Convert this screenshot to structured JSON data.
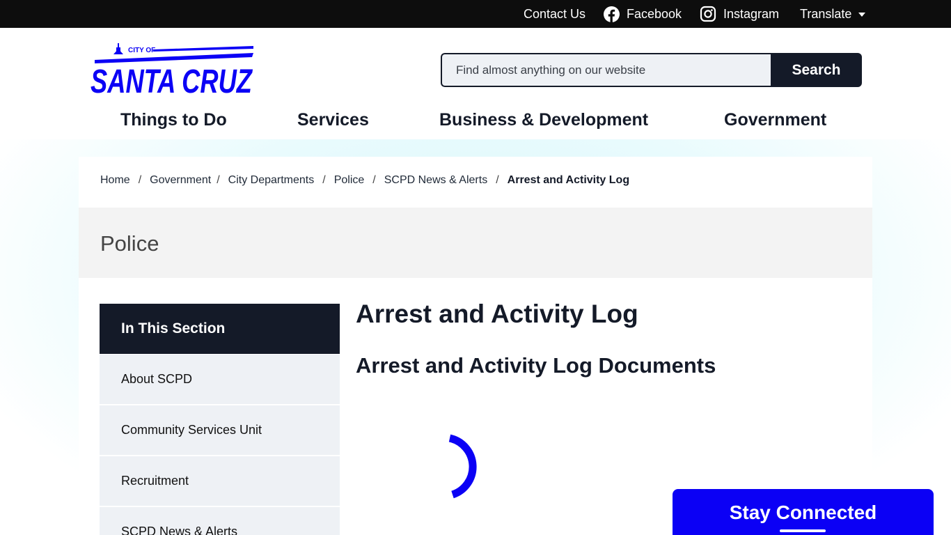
{
  "utility_bar": {
    "contact": "Contact Us",
    "facebook": "Facebook",
    "instagram": "Instagram",
    "translate": "Translate"
  },
  "logo": {
    "top_text": "CITY OF",
    "main_text": "SANTA CRUZ",
    "color": "#0b00f5"
  },
  "search": {
    "placeholder": "Find almost anything on our website",
    "value": "",
    "button": "Search"
  },
  "nav": {
    "things_to_do": "Things to Do",
    "services": "Services",
    "business": "Business & Development",
    "government": "Government"
  },
  "breadcrumb": {
    "items": [
      "Home",
      "Government",
      "City Departments",
      "Police",
      "SCPD News & Alerts"
    ],
    "current": "Arrest and Activity Log",
    "separator": "/"
  },
  "department": "Police",
  "sidebar": {
    "heading": "In This Section",
    "items": [
      "About SCPD",
      "Community Services Unit",
      "Recruitment",
      "SCPD News & Alerts"
    ]
  },
  "main": {
    "title": "Arrest and Activity Log",
    "subtitle": "Arrest and Activity Log Documents"
  },
  "stay_connected": "Stay Connected",
  "colors": {
    "brand_blue": "#0b00f5",
    "dark_navy": "#141a28",
    "top_bar": "#0d0d0d",
    "sidebar_bg": "#eef1f5"
  },
  "icons": {
    "facebook": "facebook-icon",
    "instagram": "instagram-icon",
    "translate_caret": "caret-down-icon",
    "loading": "loading-spinner-icon"
  }
}
